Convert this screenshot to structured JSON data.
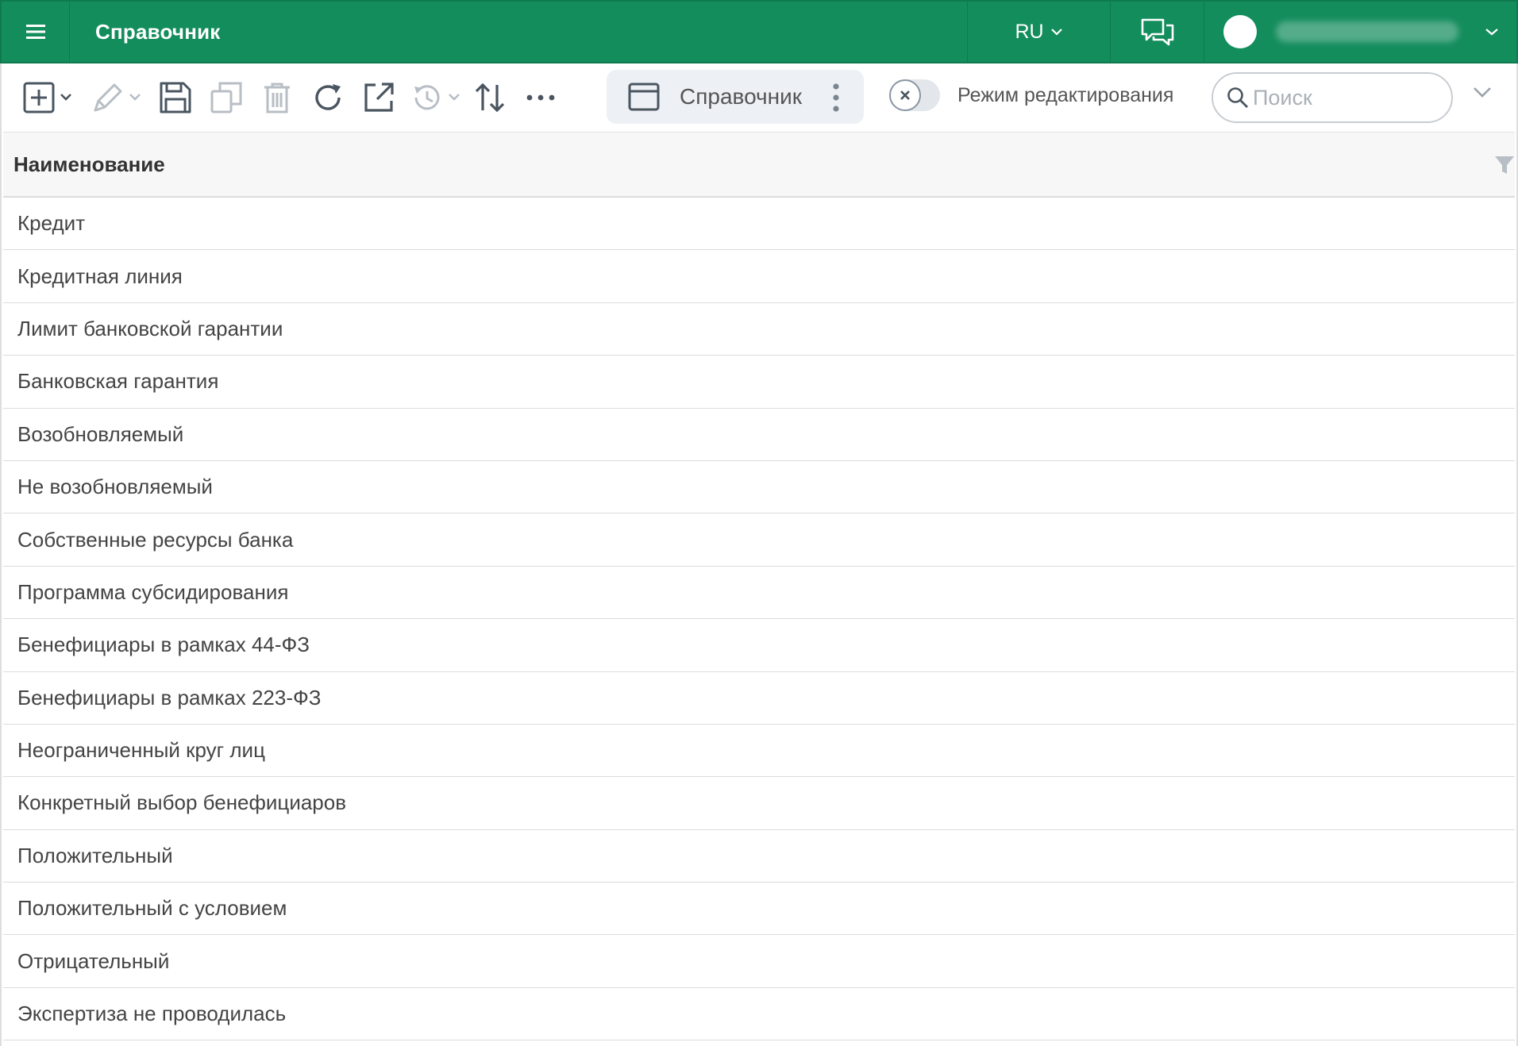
{
  "header": {
    "title": "Справочник",
    "language": "RU",
    "colors": {
      "bar": "#148d5d",
      "text": "#ffffff"
    }
  },
  "toolbar": {
    "tab_label": "Справочник",
    "edit_mode_label": "Режим редактирования",
    "edit_mode_on": false,
    "search_placeholder": "Поиск",
    "icons": [
      "add-icon",
      "edit-icon",
      "save-icon",
      "copy-icon",
      "delete-icon",
      "refresh-icon",
      "open-external-icon",
      "history-icon",
      "sort-icon",
      "more-icon"
    ]
  },
  "table": {
    "column_header": "Наименование",
    "rows": [
      "Кредит",
      "Кредитная линия",
      "Лимит банковской гарантии",
      "Банковская гарантия",
      "Возобновляемый",
      "Не возобновляемый",
      "Собственные ресурсы банка",
      "Программа субсидирования",
      "Бенефициары в рамках 44-ФЗ",
      "Бенефициары в рамках 223-ФЗ",
      "Неограниченный круг лиц",
      "Конкретный выбор бенефициаров",
      "Положительный",
      "Положительный с условием",
      "Отрицательный",
      "Экспертиза не проводилась"
    ]
  }
}
